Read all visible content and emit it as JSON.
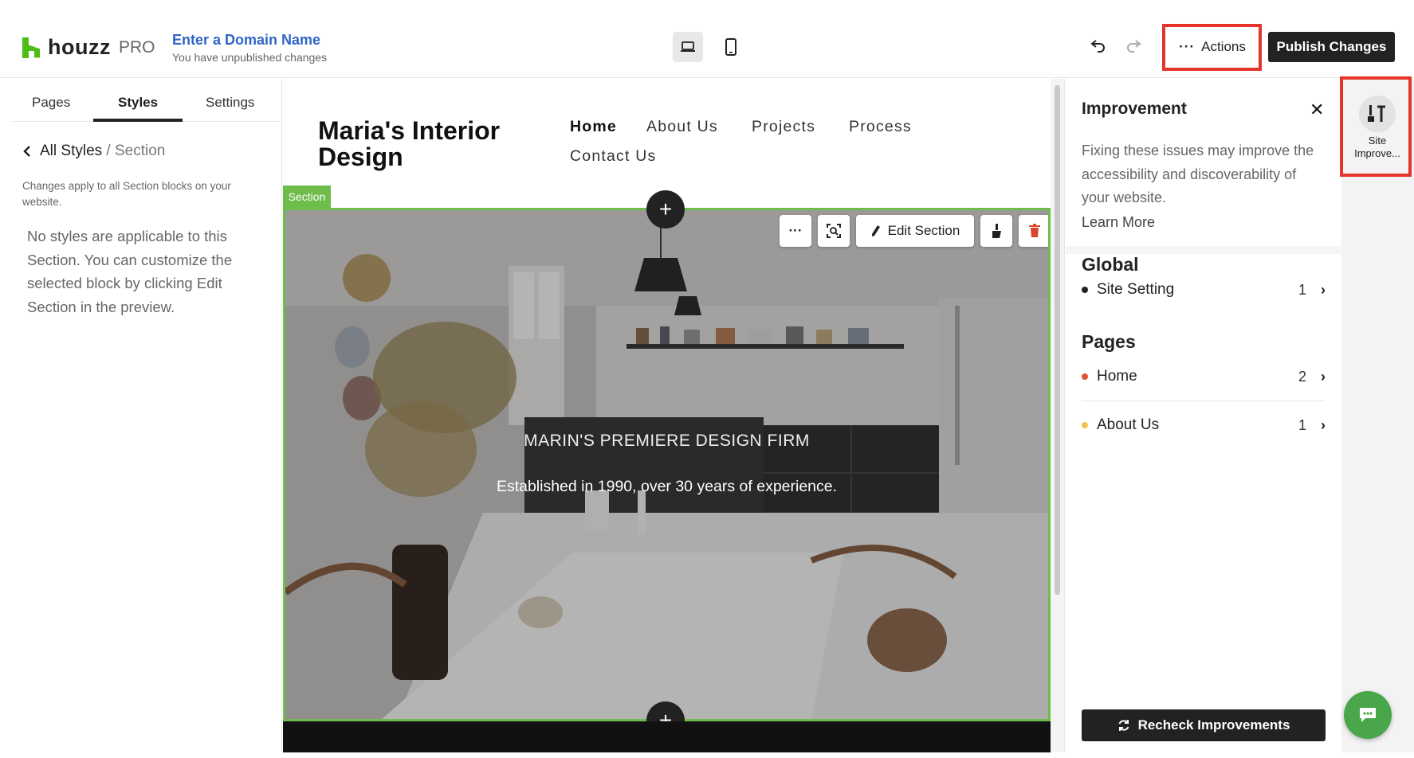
{
  "brand": {
    "name": "houzz",
    "suffix": "PRO",
    "accent": "#4dbc15"
  },
  "domain": {
    "link": "Enter a Domain Name",
    "subtitle": "You have unpublished changes"
  },
  "toolbar": {
    "devices": [
      {
        "name": "desktop",
        "icon": "laptop-icon",
        "active": true
      },
      {
        "name": "mobile",
        "icon": "phone-icon",
        "active": false
      }
    ],
    "undo_icon": "undo-icon",
    "redo_icon": "redo-icon",
    "actions_label": "Actions",
    "publish_label": "Publish Changes",
    "highlight_color": "#e5352a"
  },
  "left_panel": {
    "tabs": [
      "Pages",
      "Styles",
      "Settings"
    ],
    "active_tab": "Styles",
    "breadcrumb": {
      "root": "All Styles",
      "separator": "/",
      "current": "Section"
    },
    "note": "Changes apply to all Section blocks on your website.",
    "message": "No styles are applicable to this Section. You can customize the selected block by clicking Edit Section in the preview."
  },
  "preview": {
    "site_title": "Maria's Interior Design",
    "nav": [
      "Home",
      "About Us",
      "Projects",
      "Process",
      "Contact Us"
    ],
    "active_nav": "Home",
    "section_tag": "Section",
    "section_border_color": "#6ebd4a",
    "hero": {
      "eyebrow": "MARIN'S PREMIERE DESIGN FIRM",
      "subtitle": "Established in 1990, over 30 years of experience."
    },
    "section_tools": {
      "edit_label": "Edit Section"
    }
  },
  "improvement": {
    "title": "Improvement",
    "description": "Fixing these issues may improve the accessibility and discoverability of your website.",
    "learn_more": "Learn More",
    "groups": [
      {
        "title": "Global",
        "items": [
          {
            "label": "Site Setting",
            "count": "1",
            "dot": "#222222"
          }
        ]
      },
      {
        "title": "Pages",
        "items": [
          {
            "label": "Home",
            "count": "2",
            "dot": "#e0533a"
          },
          {
            "label": "About Us",
            "count": "1",
            "dot": "#f2c14e"
          }
        ]
      }
    ],
    "recheck_label": "Recheck Improvements"
  },
  "rail": {
    "label": "Site Improve...",
    "icon": "site-improvement-icon"
  },
  "chat": {
    "icon": "chat-icon",
    "color": "#4aa64a"
  }
}
